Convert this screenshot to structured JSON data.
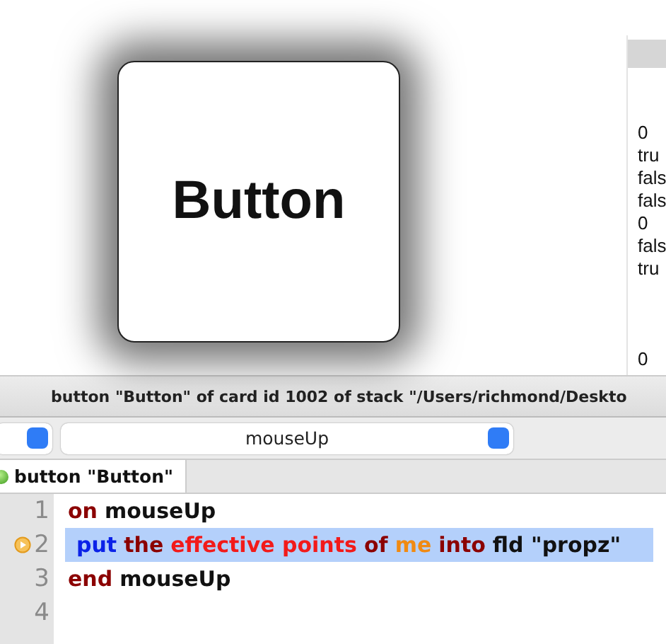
{
  "canvas": {
    "button": {
      "label": "Button"
    },
    "field": {
      "values": [
        "0",
        "tru",
        "fals",
        "fals",
        "0",
        "fals",
        "tru"
      ],
      "trailing_value": "0"
    }
  },
  "title_bar": {
    "title": "button \"Button\" of card id 1002 of stack \"/Users/richmond/Deskto"
  },
  "handler_menu": {
    "value": "mouseUp"
  },
  "tabs": [
    {
      "label": "button \"Button\"",
      "selected": true
    }
  ],
  "script": {
    "lines": [
      {
        "number": "1",
        "breakpoint": false,
        "selected": false,
        "tokens": [
          {
            "text": "on",
            "kind": "keyword"
          },
          {
            "text": "mouseUp",
            "kind": "plain"
          }
        ]
      },
      {
        "number": "2",
        "breakpoint": true,
        "selected": true,
        "tokens": [
          {
            "text": "put",
            "kind": "command"
          },
          {
            "text": "the",
            "kind": "keyword"
          },
          {
            "text": "effective points",
            "kind": "property"
          },
          {
            "text": "of",
            "kind": "keyword"
          },
          {
            "text": "me",
            "kind": "builtin"
          },
          {
            "text": "into",
            "kind": "keyword"
          },
          {
            "text": "fld \"propz\"",
            "kind": "plain"
          }
        ]
      },
      {
        "number": "3",
        "breakpoint": false,
        "selected": false,
        "tokens": [
          {
            "text": "end",
            "kind": "keyword"
          },
          {
            "text": "mouseUp",
            "kind": "plain"
          }
        ]
      },
      {
        "number": "4",
        "breakpoint": false,
        "selected": false
      }
    ]
  }
}
